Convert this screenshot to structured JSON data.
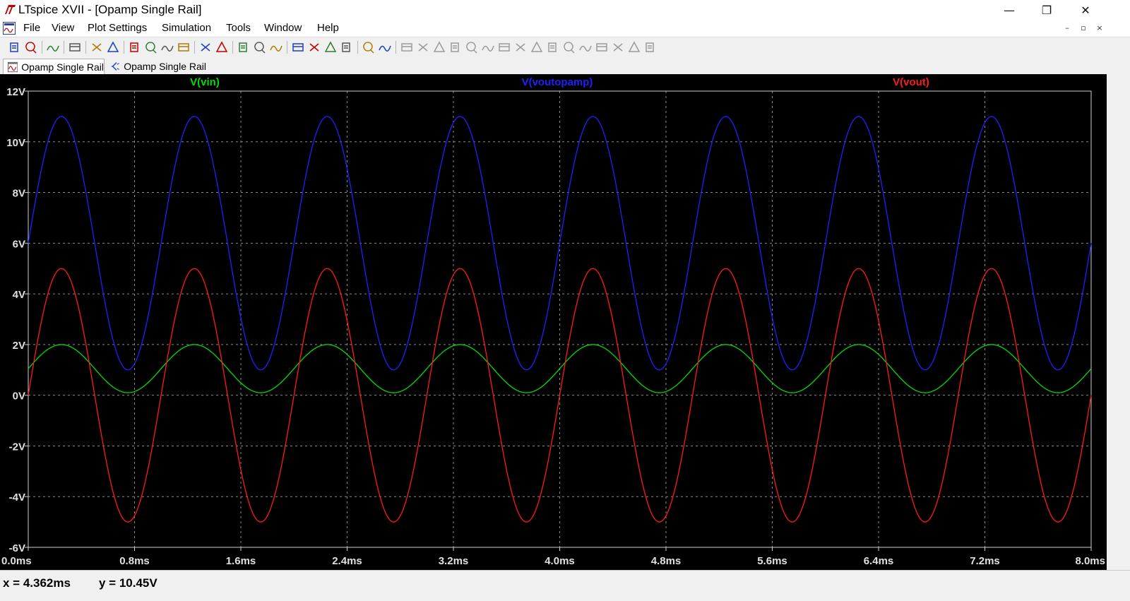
{
  "window": {
    "title": "LTspice XVII - [Opamp Single Rail]",
    "controls": {
      "minimize": "—",
      "maximize": "❐",
      "close": "✕"
    }
  },
  "menu": {
    "items": [
      "File",
      "View",
      "Plot Settings",
      "Simulation",
      "Tools",
      "Window",
      "Help"
    ],
    "mdi_controls": [
      "–",
      "▫",
      "×"
    ]
  },
  "toolbar": {
    "groups": [
      [
        "new-schematic-icon",
        "open-icon"
      ],
      [
        "save-icon"
      ],
      [
        "control-panel-icon"
      ],
      [
        "run-icon",
        "halt-icon"
      ],
      [
        "zoom-area-icon",
        "zoom-in-icon",
        "zoom-out-icon",
        "zoom-fit-icon"
      ],
      [
        "autorange-icon",
        "plot-settings-icon"
      ],
      [
        "tile-horizontal-icon",
        "cascade-icon",
        "tile-vertical-icon"
      ],
      [
        "cut-icon",
        "copy-icon",
        "paste-icon",
        "find-icon"
      ],
      [
        "print-preview-icon",
        "print-icon"
      ],
      [
        "wire-icon",
        "ground-icon",
        "label-icon",
        "resistor-icon",
        "capacitor-icon",
        "inductor-icon",
        "diode-icon",
        "component-icon",
        "move-icon",
        "drag-icon",
        "undo-icon",
        "redo-icon",
        "rotate-icon",
        "mirror-icon",
        "text-icon",
        "spice-directive-icon"
      ]
    ]
  },
  "tabs": [
    {
      "label": "Opamp Single Rail",
      "icon": "waveform-icon",
      "active": true
    },
    {
      "label": "Opamp Single Rail",
      "icon": "schematic-icon",
      "active": false
    }
  ],
  "status": {
    "x_readout": "x = 4.362ms",
    "y_readout": "y = 10.45V"
  },
  "chart_data": {
    "type": "line",
    "background": "#000000",
    "grid": true,
    "xlim": [
      0,
      8.0
    ],
    "ylim": [
      -6,
      12
    ],
    "x_unit": "ms",
    "y_unit": "V",
    "x_ticks": [
      "0.0ms",
      "0.8ms",
      "1.6ms",
      "2.4ms",
      "3.2ms",
      "4.0ms",
      "4.8ms",
      "5.6ms",
      "6.4ms",
      "7.2ms",
      "8.0ms"
    ],
    "y_ticks": [
      "12V",
      "10V",
      "8V",
      "6V",
      "4V",
      "2V",
      "0V",
      "-2V",
      "-4V",
      "-6V"
    ],
    "series": [
      {
        "name": "V(vin)",
        "color": "#00dd00",
        "offset": 1.05,
        "amplitude": 0.95,
        "frequency_khz": 1.0,
        "phase": "sine"
      },
      {
        "name": "V(voutopamp)",
        "color": "#2020ff",
        "offset": 6.0,
        "amplitude": 5.0,
        "frequency_khz": 1.0,
        "phase": "sine"
      },
      {
        "name": "V(vout)",
        "color": "#ff1a1a",
        "offset": 0.0,
        "amplitude": 5.0,
        "frequency_khz": 1.0,
        "phase": "sine"
      }
    ],
    "points": {
      "x": [
        0.0,
        0.25,
        0.5,
        0.75,
        1.0,
        1.25,
        1.5,
        1.75,
        2.0,
        2.25,
        2.5,
        2.75,
        3.0,
        3.25,
        3.5,
        3.75,
        4.0,
        4.25,
        4.5,
        4.75,
        5.0,
        5.25,
        5.5,
        5.75,
        6.0,
        6.25,
        6.5,
        6.75,
        7.0,
        7.25,
        7.5,
        7.75,
        8.0
      ],
      "V(vin)": [
        1.05,
        2.0,
        1.05,
        0.1,
        1.05,
        2.0,
        1.05,
        0.1,
        1.05,
        2.0,
        1.05,
        0.1,
        1.05,
        2.0,
        1.05,
        0.1,
        1.05,
        2.0,
        1.05,
        0.1,
        1.05,
        2.0,
        1.05,
        0.1,
        1.05,
        2.0,
        1.05,
        0.1,
        1.05,
        2.0,
        1.05,
        0.1,
        1.05
      ],
      "V(voutopamp)": [
        6.0,
        11.0,
        6.0,
        1.0,
        6.0,
        11.0,
        6.0,
        1.0,
        6.0,
        11.0,
        6.0,
        1.0,
        6.0,
        11.0,
        6.0,
        1.0,
        6.0,
        11.0,
        6.0,
        1.0,
        6.0,
        11.0,
        6.0,
        1.0,
        6.0,
        11.0,
        6.0,
        1.0,
        6.0,
        11.0,
        6.0,
        1.0,
        6.0
      ],
      "V(vout)": [
        0.0,
        5.0,
        0.0,
        -5.0,
        0.0,
        5.0,
        0.0,
        -5.0,
        0.0,
        5.0,
        0.0,
        -5.0,
        0.0,
        5.0,
        0.0,
        -5.0,
        0.0,
        5.0,
        0.0,
        -5.0,
        0.0,
        5.0,
        0.0,
        -5.0,
        0.0,
        5.0,
        0.0,
        -5.0,
        0.0,
        5.0,
        0.0,
        -5.0,
        0.0
      ]
    }
  }
}
